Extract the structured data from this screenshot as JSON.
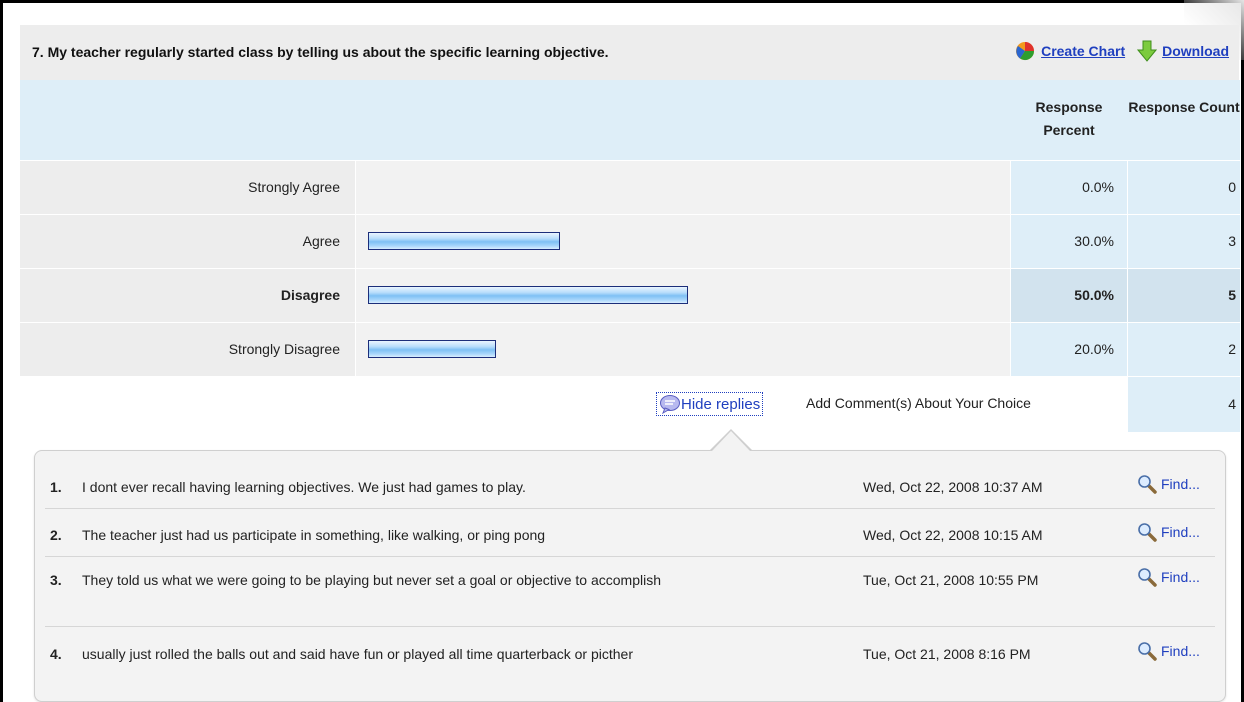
{
  "question": {
    "title": "7. My teacher regularly started class by telling us about the specific learning objective.",
    "create_chart_label": "Create Chart",
    "download_label": "Download"
  },
  "table": {
    "headers": {
      "percent": "Response Percent",
      "count": "Response Count"
    },
    "rows": [
      {
        "label": "Strongly Agree",
        "percent": "0.0%",
        "count": "0",
        "bold": false
      },
      {
        "label": "Agree",
        "percent": "30.0%",
        "count": "3",
        "bold": false
      },
      {
        "label": "Disagree",
        "percent": "50.0%",
        "count": "5",
        "bold": true
      },
      {
        "label": "Strongly Disagree",
        "percent": "20.0%",
        "count": "2",
        "bold": false
      }
    ]
  },
  "chart_data": {
    "type": "bar",
    "categories": [
      "Strongly Agree",
      "Agree",
      "Disagree",
      "Strongly Disagree"
    ],
    "values": [
      0.0,
      30.0,
      50.0,
      20.0
    ],
    "counts": [
      0,
      3,
      5,
      2
    ]
  },
  "comments": {
    "toggle_label": "Hide replies",
    "label": "Add Comment(s) About Your Choice",
    "count": "4",
    "find_label": "Find...",
    "items": [
      {
        "num": "1.",
        "text": "I dont ever recall having learning objectives. We just had games to play.",
        "date": "Wed, Oct 22, 2008 10:37 AM"
      },
      {
        "num": "2.",
        "text": "The teacher just had us participate in something, like walking, or ping pong",
        "date": "Wed, Oct 22, 2008 10:15 AM"
      },
      {
        "num": "3.",
        "text": "They told us what we were going to be playing but never set a goal or objective to accomplish",
        "date": "Tue, Oct 21, 2008 10:55 PM"
      },
      {
        "num": "4.",
        "text": "usually just rolled the balls out and said have fun or played all time quarterback or picther",
        "date": "Tue, Oct 21, 2008 8:16 PM"
      }
    ]
  },
  "colors": {
    "link": "#1f3fbf",
    "header_bg": "#ededed",
    "data_bg": "#deeef8",
    "bar_border": "#1c2e7a"
  }
}
